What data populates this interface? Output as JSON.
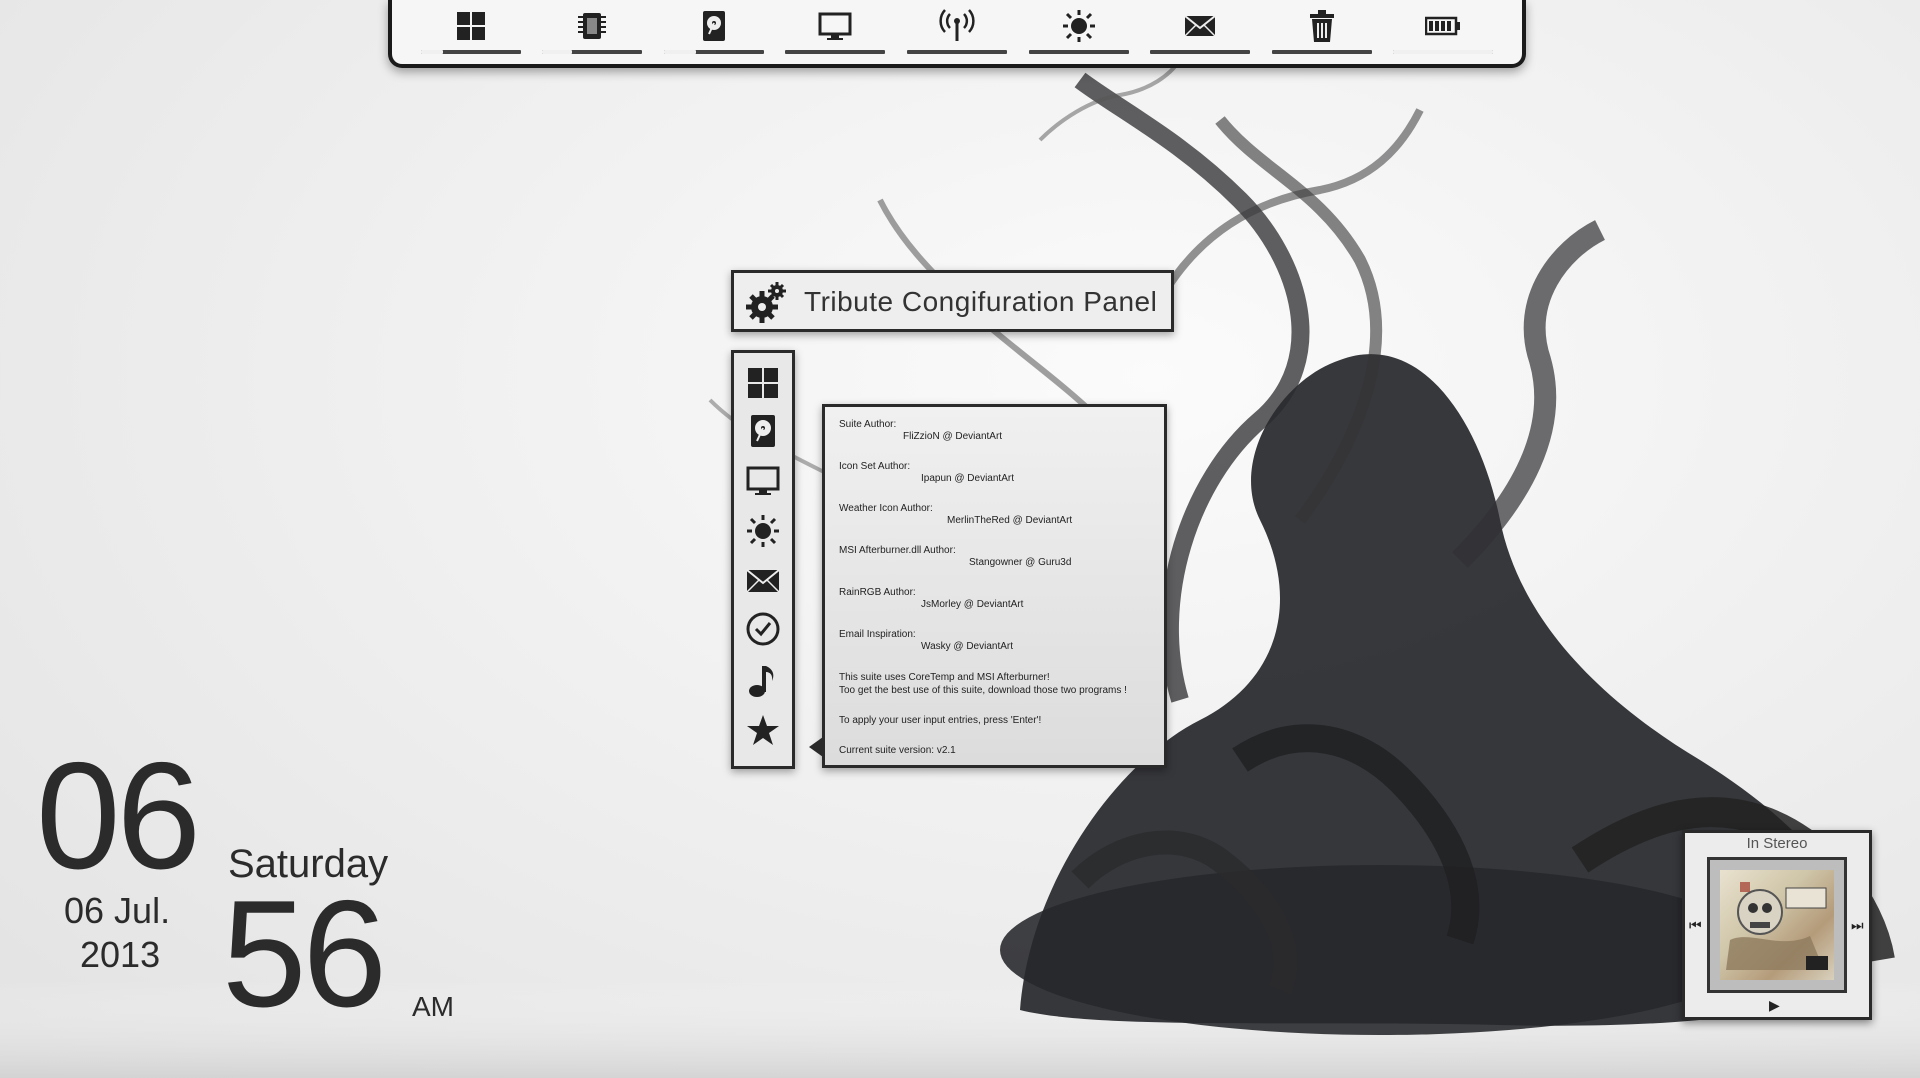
{
  "taskbar": {
    "items": [
      {
        "name": "windows-icon",
        "fill": 0.0
      },
      {
        "name": "cpu-icon",
        "fill": 0.0
      },
      {
        "name": "harddrive-icon",
        "fill": 0.0
      },
      {
        "name": "monitor-icon",
        "fill": 0.0
      },
      {
        "name": "wireless-icon",
        "fill": 0.0
      },
      {
        "name": "weather-sun-icon",
        "fill": 0.0
      },
      {
        "name": "mail-icon",
        "fill": 0.0
      },
      {
        "name": "recycle-bin-icon",
        "fill": 0.0
      },
      {
        "name": "battery-icon",
        "fill": 0.0
      }
    ]
  },
  "config_panel": {
    "title": "Tribute Congifuration Panel",
    "menu_icons": [
      "windows-icon",
      "harddrive-icon",
      "monitor-icon",
      "weather-sun-icon",
      "mail-icon",
      "clock-icon",
      "music-note-icon",
      "star-icon"
    ]
  },
  "credits": {
    "entries": [
      {
        "label": "Suite Author:",
        "value": "FliZzioN @ DeviantArt"
      },
      {
        "label": "Icon Set Author:",
        "value": "Ipapun @ DeviantArt"
      },
      {
        "label": "Weather Icon Author:",
        "value": "MerlinTheRed @ DeviantArt"
      },
      {
        "label": "MSI Afterburner.dll Author:",
        "value": "Stangowner @ Guru3d"
      },
      {
        "label": "RainRGB Author:",
        "value": "JsMorley @ DeviantArt"
      },
      {
        "label": "Email Inspiration:",
        "value": "Wasky @ DeviantArt"
      }
    ],
    "note_line1": "This suite uses CoreTemp and MSI Afterburner!",
    "note_line2": "Too get the best use of this suite, download those two programs !",
    "enter_note": "To apply your user input entries, press 'Enter'!",
    "version": "Current suite version: v2.1"
  },
  "clock": {
    "hour": "06",
    "minute": "56",
    "weekday": "Saturday",
    "date": "06 Jul.",
    "year": "2013",
    "ampm": "AM"
  },
  "player": {
    "title": "In Stereo",
    "prev_symbol": "⏮",
    "next_symbol": "⏭",
    "play_symbol": "▶"
  }
}
